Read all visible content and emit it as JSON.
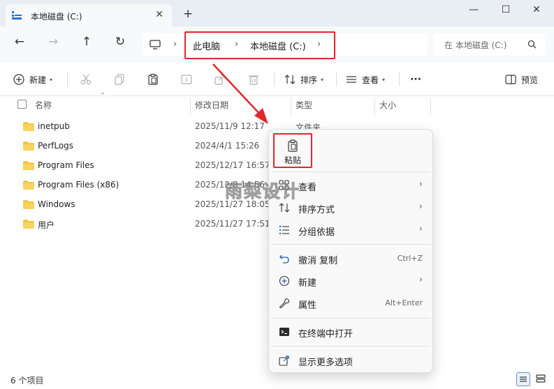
{
  "titlebar": {
    "tab_title": "本地磁盘 (C:)",
    "tab_close": "✕",
    "new_tab": "+",
    "minimize": "—",
    "maximize": "☐",
    "close": "✕"
  },
  "address": {
    "breadcrumbs": [
      "此电脑",
      "本地磁盘 (C:)"
    ],
    "separator": "›",
    "search_placeholder": "在 本地磁盘 (C:)"
  },
  "toolbar": {
    "new_label": "新建",
    "sort_label": "排序",
    "view_label": "查看",
    "more_label": "···",
    "preview_label": "预览"
  },
  "columns": {
    "name": "名称",
    "modified": "修改日期",
    "type": "类型",
    "size": "大小"
  },
  "files": [
    {
      "name": "inetpub",
      "date": "2025/11/9 12:17"
    },
    {
      "name": "PerfLogs",
      "date": "2024/4/1 15:26"
    },
    {
      "name": "Program Files",
      "date": "2025/12/17 16:57"
    },
    {
      "name": "Program Files (x86)",
      "date": "2025/12/8 14:56"
    },
    {
      "name": "Windows",
      "date": "2025/11/27 18:05"
    },
    {
      "name": "用户",
      "date": "2025/11/27 17:51"
    }
  ],
  "first_row_type": "文件夹",
  "status": {
    "item_count": "6 个项目"
  },
  "context_menu": {
    "paste_label": "粘贴",
    "items": [
      {
        "label": "查看",
        "icon": "grid-view-icon",
        "submenu": true
      },
      {
        "label": "排序方式",
        "icon": "sort-icon",
        "submenu": true
      },
      {
        "label": "分组依据",
        "icon": "group-list-icon",
        "submenu": true
      },
      {
        "label": "撤消 复制",
        "icon": "undo-icon",
        "shortcut": "Ctrl+Z"
      },
      {
        "label": "新建",
        "icon": "plus-circle-icon",
        "submenu": true
      },
      {
        "label": "属性",
        "icon": "wrench-icon",
        "shortcut": "Alt+Enter"
      },
      {
        "label": "在终端中打开",
        "icon": "terminal-icon"
      },
      {
        "label": "显示更多选项",
        "icon": "share-icon"
      }
    ],
    "submenu_arrow": "›"
  },
  "watermark": "雨梨设计",
  "colors": {
    "highlight_red": "#e3262c",
    "folder_yellow": "#f4c542",
    "accent_blue": "#1a5fb4"
  }
}
